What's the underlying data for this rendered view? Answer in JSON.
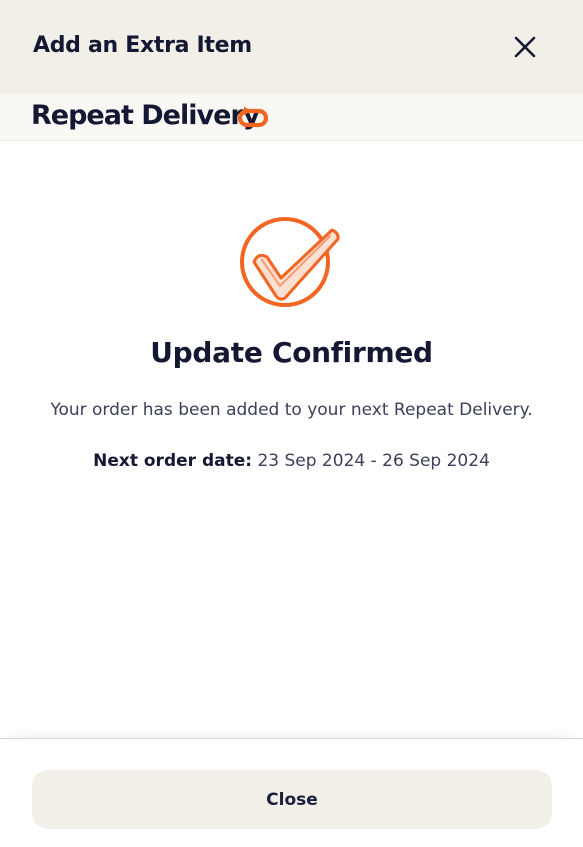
{
  "header": {
    "title": "Add an Extra Item",
    "close_icon": "close-icon"
  },
  "brand": {
    "title": "Repeat Delivery",
    "icon": "repeat-icon",
    "accent": "#f26522"
  },
  "confirmation": {
    "icon": "check-circle-icon",
    "title": "Update Confirmed",
    "message": "Your order has been added to your next Repeat Delivery.",
    "next_order_label": "Next order date:",
    "next_order_value": "23 Sep 2024 - 26 Sep 2024"
  },
  "footer": {
    "close_label": "Close"
  },
  "colors": {
    "header_bg": "#f2eee8",
    "text_dark": "#141833",
    "accent": "#f26522"
  }
}
